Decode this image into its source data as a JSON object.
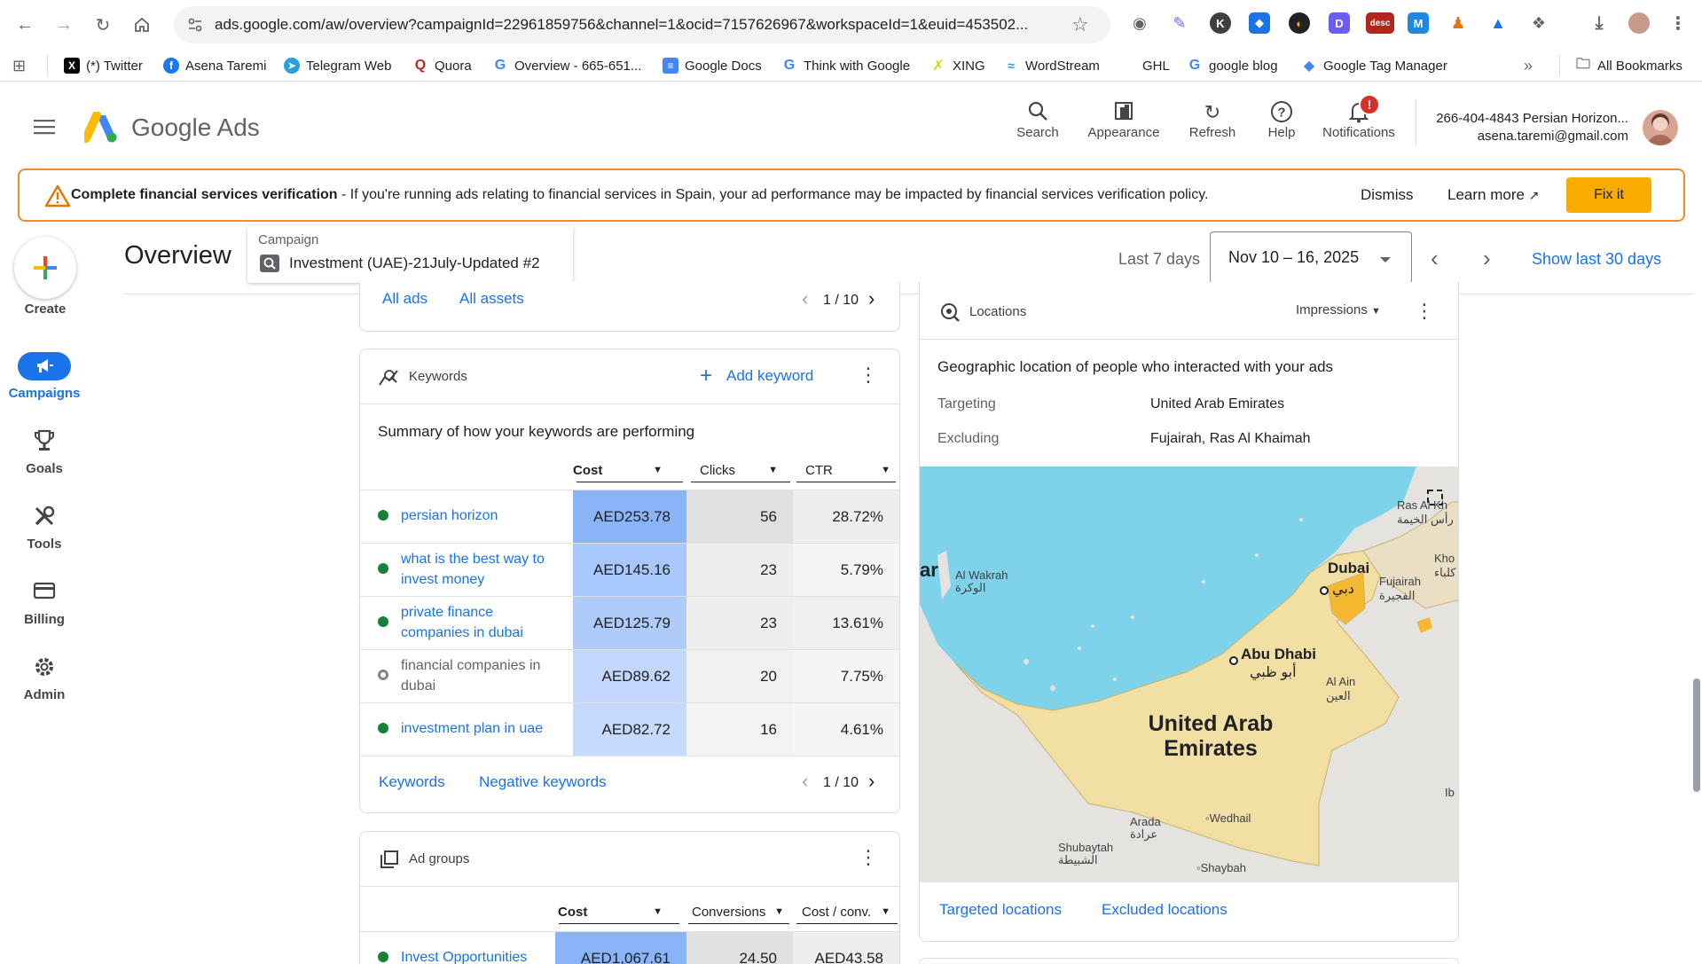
{
  "browser": {
    "url": "ads.google.com/aw/overview?campaignId=22961859756&channel=1&ocid=7157626967&workspaceId=1&euid=453502...",
    "bookmarks": [
      "(*) Twitter",
      "Asena Taremi",
      "Telegram Web",
      "Quora",
      "Overview - 665-651...",
      "Google Docs",
      "Think with Google",
      "XING",
      "WordStream",
      "GHL",
      "google blog",
      "Google Tag Manager"
    ],
    "all_bookmarks": "All Bookmarks",
    "more": "»",
    "desc_ext": "desc"
  },
  "header": {
    "product": "Google Ads",
    "actions": [
      "Search",
      "Appearance",
      "Refresh",
      "Help",
      "Notifications"
    ],
    "notif_badge": "!",
    "account_name": "266-404-4843 Persian Horizon...",
    "account_email": "asena.taremi@gmail.com"
  },
  "banner": {
    "bold": "Complete financial services verification",
    "text": " - If you're running ads relating to financial services in Spain, your ad performance may be impacted by financial services verification policy.",
    "dismiss": "Dismiss",
    "learn_more": "Learn more",
    "fix_it": "Fix it"
  },
  "nav": {
    "create": "Create",
    "items": [
      "Campaigns",
      "Goals",
      "Tools",
      "Billing",
      "Admin"
    ]
  },
  "page": {
    "title": "Overview",
    "campaign_label": "Campaign",
    "campaign_name": "Investment (UAE)-21July-Updated #2",
    "range_label": "Last 7 days",
    "date_range": "Nov 10 – 16, 2025",
    "show_last": "Show last 30 days"
  },
  "ads_card": {
    "links": [
      "All ads",
      "All assets"
    ],
    "pager": "1 / 10"
  },
  "keywords": {
    "title": "Keywords",
    "add": "Add keyword",
    "summary": "Summary of how your keywords are performing",
    "columns": [
      "Cost",
      "Clicks",
      "CTR"
    ],
    "rows": [
      {
        "kw": "persian horizon",
        "cost": "AED253.78",
        "clicks": "56",
        "ctr": "28.72%",
        "status": "active"
      },
      {
        "kw": "what is the best way to invest money",
        "cost": "AED145.16",
        "clicks": "23",
        "ctr": "5.79%",
        "status": "active"
      },
      {
        "kw": "private finance companies in dubai",
        "cost": "AED125.79",
        "clicks": "23",
        "ctr": "13.61%",
        "status": "active"
      },
      {
        "kw": "financial companies in dubai",
        "cost": "AED89.62",
        "clicks": "20",
        "ctr": "7.75%",
        "status": "paused"
      },
      {
        "kw": "investment plan in uae",
        "cost": "AED82.72",
        "clicks": "16",
        "ctr": "4.61%",
        "status": "active"
      }
    ],
    "footer_links": [
      "Keywords",
      "Negative keywords"
    ],
    "pager": "1 / 10"
  },
  "ad_groups": {
    "title": "Ad groups",
    "columns": [
      "Cost",
      "Conversions",
      "Cost / conv."
    ],
    "rows": [
      {
        "name": "Invest Opportunities",
        "cost": "AED1,067.61",
        "conv": "24.50",
        "cpc": "AED43.58"
      }
    ]
  },
  "locations": {
    "title": "Locations",
    "metric": "Impressions",
    "subtitle": "Geographic location of people who interacted with your ads",
    "targeting_label": "Targeting",
    "targeting_value": "United Arab Emirates",
    "excluding_label": "Excluding",
    "excluding_value": "Fujairah, Ras Al Khaimah",
    "footer_links": [
      "Targeted locations",
      "Excluded locations"
    ],
    "map_labels": {
      "country1": "United Arab",
      "country2": "Emirates",
      "dubai": "Dubai",
      "dubai_ar": "دبي",
      "abudhabi": "Abu Dhabi",
      "abudhabi_ar": "أبو ظبي",
      "alwakrah": "Al Wakrah",
      "alwakrah_ar": "الوكرة",
      "ar": "ar",
      "rask": "Ras Al Kh",
      "rask_ar": "رأس الخيمة",
      "fujairah": "Fujairah",
      "fujairah_ar": "الفجيرة",
      "khor": "Kho",
      "khor_ar": "كلباء",
      "alain": "Al Ain",
      "alain_ar": "العين",
      "arada": "Arada",
      "arada_ar": "عرادة",
      "wedhail": "Wedhail",
      "shubaytah": "Shubaytah",
      "shubaytah_ar": "الشبيطة",
      "shaybah": "Shaybah",
      "ib": "Ib"
    }
  }
}
